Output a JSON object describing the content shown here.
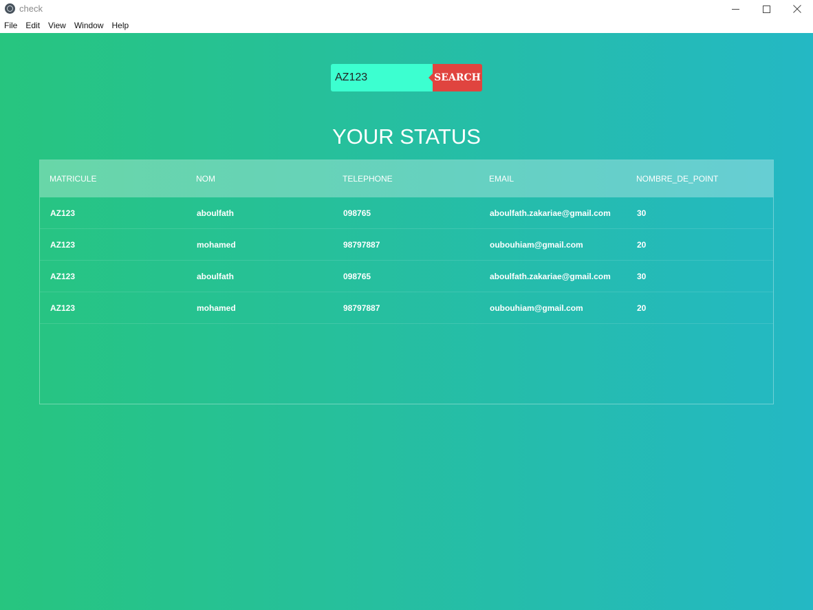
{
  "window": {
    "title": "check"
  },
  "menu": {
    "file": "File",
    "edit": "Edit",
    "view": "View",
    "window": "Window",
    "help": "Help"
  },
  "search": {
    "value": "AZ123",
    "button_label": "SEARCH"
  },
  "heading": "YOUR STATUS",
  "table": {
    "columns": [
      "MATRICULE",
      "NOM",
      "TELEPHONE",
      "EMAIL",
      "NOMBRE_DE_POINT"
    ],
    "rows": [
      [
        "AZ123",
        "aboulfath",
        "098765",
        "aboulfath.zakariae@gmail.com",
        "30"
      ],
      [
        "AZ123",
        "mohamed",
        "98797887",
        "oubouhiam@gmail.com",
        "20"
      ],
      [
        "AZ123",
        "aboulfath",
        "098765",
        "aboulfath.zakariae@gmail.com",
        "30"
      ],
      [
        "AZ123",
        "mohamed",
        "98797887",
        "oubouhiam@gmail.com",
        "20"
      ]
    ]
  },
  "icons": {
    "app": "electron-app-icon",
    "minimize": "minimize-icon",
    "maximize": "maximize-icon",
    "close": "close-icon"
  },
  "colors": {
    "gradient_start": "#27c57f",
    "gradient_end": "#24b8c4",
    "search_input_bg": "#3cffd0",
    "search_button_bg": "#e0443f"
  }
}
